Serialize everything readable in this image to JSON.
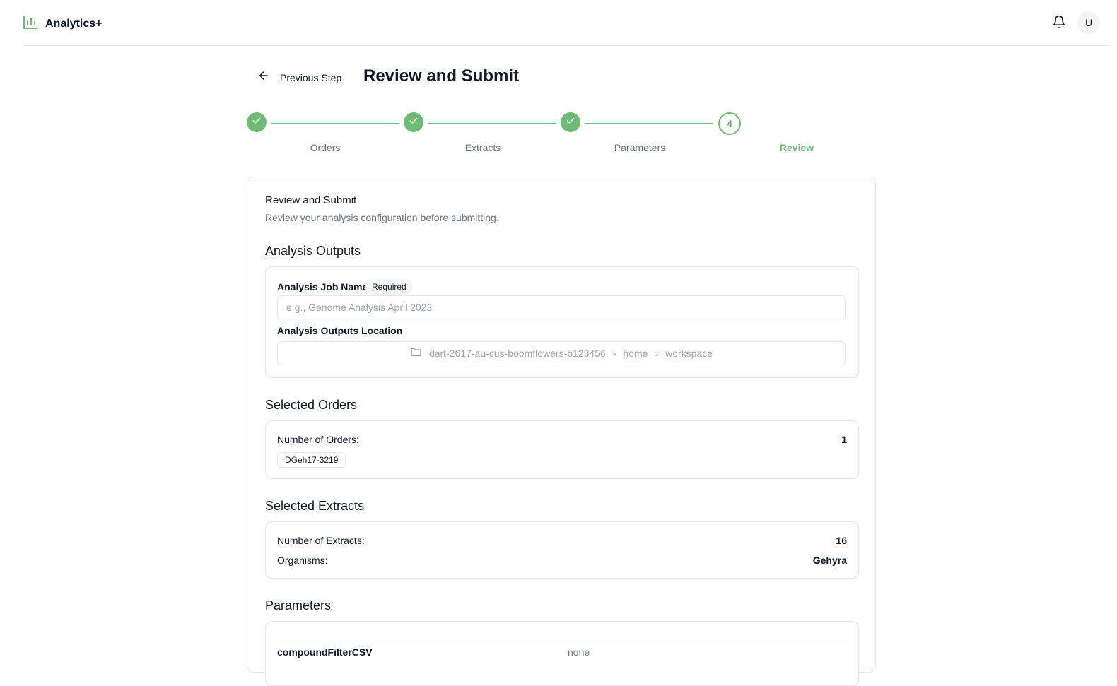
{
  "app": {
    "name": "Analytics+",
    "user_initial": "U"
  },
  "header": {
    "back_label": "Previous Step",
    "title": "Review and Submit"
  },
  "stepper": {
    "steps": [
      {
        "label": "Orders",
        "status": "complete"
      },
      {
        "label": "Extracts",
        "status": "complete"
      },
      {
        "label": "Parameters",
        "status": "complete"
      },
      {
        "label": "Review",
        "status": "current",
        "number": "4"
      }
    ]
  },
  "card": {
    "title": "Review and Submit",
    "subtitle": "Review your analysis configuration before submitting."
  },
  "outputs": {
    "section_title": "Analysis Outputs",
    "job_name_label": "Analysis Job Name",
    "required_badge": "Required",
    "job_name_value": "",
    "job_name_placeholder": "e.g., Genome Analysis April 2023",
    "location_label": "Analysis Outputs Location",
    "location_path": [
      "dart-2617-au-cus-boomflowers-b123456",
      "home",
      "workspace"
    ]
  },
  "orders": {
    "section_title": "Selected Orders",
    "count_label": "Number of Orders:",
    "count": "1",
    "chips": [
      "DGeh17-3219"
    ]
  },
  "extracts": {
    "section_title": "Selected Extracts",
    "count_label": "Number of Extracts:",
    "count": "16",
    "organisms_label": "Organisms:",
    "organisms": "Gehyra"
  },
  "parameters": {
    "section_title": "Parameters",
    "rows": [
      {
        "name": "compoundFilterCSV",
        "value": "none"
      }
    ]
  },
  "colors": {
    "accent": "#6dbb74",
    "text_primary": "#111827",
    "text_muted": "#6b7280",
    "border": "#e5e7eb"
  }
}
